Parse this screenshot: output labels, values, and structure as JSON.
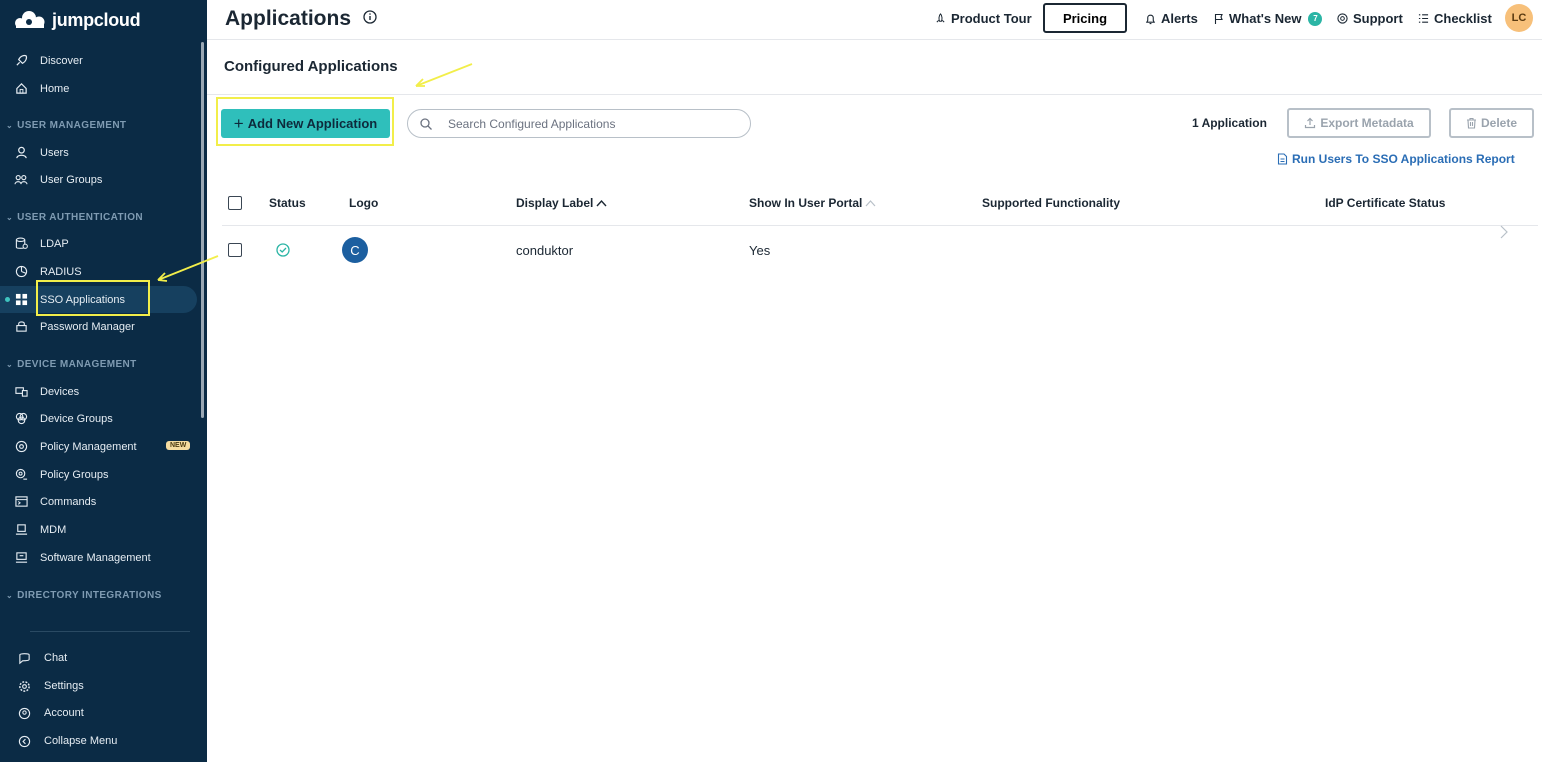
{
  "brand": {
    "name": "jumpcloud"
  },
  "colors": {
    "sidebar": "#0b2b45",
    "accent": "#2fbfbb",
    "highlight": "#f2ee4a",
    "link": "#2a6db5"
  },
  "sidebar": {
    "top_items": [
      {
        "label": "Discover",
        "icon": "rocket-icon"
      },
      {
        "label": "Home",
        "icon": "home-icon"
      }
    ],
    "sections": [
      {
        "title": "USER MANAGEMENT",
        "items": [
          {
            "label": "Users",
            "icon": "user-icon"
          },
          {
            "label": "User Groups",
            "icon": "user-groups-icon"
          }
        ]
      },
      {
        "title": "USER AUTHENTICATION",
        "items": [
          {
            "label": "LDAP",
            "icon": "ldap-icon"
          },
          {
            "label": "RADIUS",
            "icon": "radius-icon"
          },
          {
            "label": "SSO Applications",
            "icon": "grid-icon"
          },
          {
            "label": "Password Manager",
            "icon": "password-icon"
          }
        ]
      },
      {
        "title": "DEVICE MANAGEMENT",
        "items": [
          {
            "label": "Devices",
            "icon": "devices-icon"
          },
          {
            "label": "Device Groups",
            "icon": "device-groups-icon"
          },
          {
            "label": "Policy Management",
            "icon": "policy-icon",
            "badge": "NEW"
          },
          {
            "label": "Policy Groups",
            "icon": "policy-groups-icon"
          },
          {
            "label": "Commands",
            "icon": "terminal-icon"
          },
          {
            "label": "MDM",
            "icon": "mdm-icon"
          },
          {
            "label": "Software Management",
            "icon": "software-icon"
          }
        ]
      },
      {
        "title": "DIRECTORY INTEGRATIONS",
        "items": []
      }
    ],
    "bottom_items": [
      {
        "label": "Chat",
        "icon": "chat-icon"
      },
      {
        "label": "Settings",
        "icon": "gear-icon"
      },
      {
        "label": "Account",
        "icon": "account-icon"
      },
      {
        "label": "Collapse Menu",
        "icon": "collapse-icon"
      }
    ]
  },
  "header": {
    "title": "Applications",
    "product_tour": "Product Tour",
    "pricing": "Pricing",
    "alerts": "Alerts",
    "whats_new": "What's New",
    "whats_new_count": "7",
    "support": "Support",
    "checklist": "Checklist",
    "avatar": "LC"
  },
  "main": {
    "section_title": "Configured Applications",
    "add_button": "Add New Application",
    "search_placeholder": "Search Configured Applications",
    "app_count": "1 Application",
    "export_button": "Export Metadata",
    "delete_button": "Delete",
    "report_link": "Run Users To SSO Applications Report"
  },
  "table": {
    "columns": [
      "Status",
      "Logo",
      "Display Label",
      "Show In User Portal",
      "Supported Functionality",
      "IdP Certificate Status"
    ],
    "rows": [
      {
        "logo_letter": "C",
        "display_label": "conduktor",
        "show_in_portal": "Yes",
        "supported_functionality": "",
        "idp_status": ""
      }
    ]
  }
}
